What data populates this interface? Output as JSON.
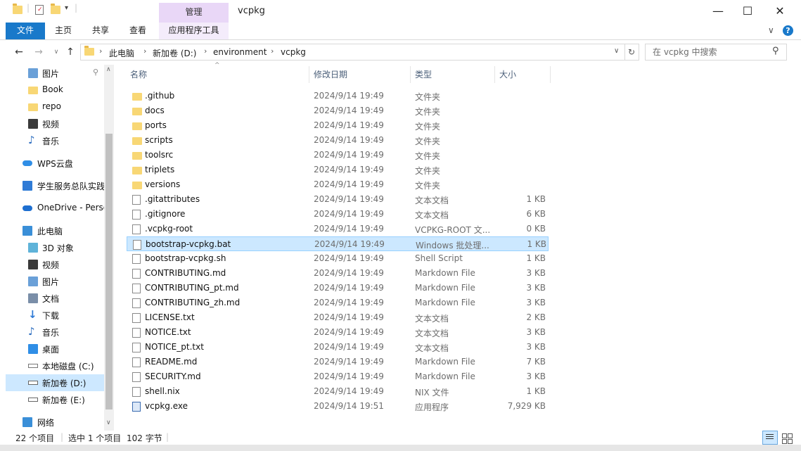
{
  "window": {
    "title": "vcpkg",
    "manage_label": "管理",
    "minimize": "—",
    "maximize": "☐",
    "close": "✕"
  },
  "ribbon": {
    "tabs": [
      "文件",
      "主页",
      "共享",
      "查看",
      "应用程序工具"
    ],
    "collapse": "∨",
    "help": "?"
  },
  "address": {
    "crumbs": [
      "此电脑",
      "新加卷 (D:)",
      "environment",
      "vcpkg"
    ],
    "search_placeholder": "在 vcpkg 中搜索"
  },
  "nav": {
    "items": [
      {
        "label": "图片",
        "icon": "pictures-icon",
        "pinned": true
      },
      {
        "label": "Book",
        "icon": "folder-icon"
      },
      {
        "label": "repo",
        "icon": "folder-icon"
      },
      {
        "label": "视频",
        "icon": "videos-icon"
      },
      {
        "label": "音乐",
        "icon": "music-icon"
      },
      {
        "label": "WPS云盘",
        "icon": "cloud-icon"
      },
      {
        "label": "学生服务总队实践",
        "icon": "cube-icon"
      },
      {
        "label": "OneDrive - Perso",
        "icon": "onedrive-icon"
      },
      {
        "label": "此电脑",
        "icon": "this-pc-icon"
      },
      {
        "label": "3D 对象",
        "icon": "3d-objects-icon"
      },
      {
        "label": "视频",
        "icon": "videos-icon"
      },
      {
        "label": "图片",
        "icon": "pictures-icon"
      },
      {
        "label": "文档",
        "icon": "documents-icon"
      },
      {
        "label": "下载",
        "icon": "downloads-icon"
      },
      {
        "label": "音乐",
        "icon": "music-icon"
      },
      {
        "label": "桌面",
        "icon": "desktop-icon"
      },
      {
        "label": "本地磁盘 (C:)",
        "icon": "drive-c-icon"
      },
      {
        "label": "新加卷 (D:)",
        "icon": "drive-icon",
        "selected": true
      },
      {
        "label": "新加卷 (E:)",
        "icon": "drive-icon"
      },
      {
        "label": "网络",
        "icon": "network-icon"
      }
    ]
  },
  "columns": {
    "name": "名称",
    "date": "修改日期",
    "type": "类型",
    "size": "大小"
  },
  "files": [
    {
      "name": ".github",
      "date": "2024/9/14 19:49",
      "type": "文件夹",
      "size": "",
      "kind": "folder"
    },
    {
      "name": "docs",
      "date": "2024/9/14 19:49",
      "type": "文件夹",
      "size": "",
      "kind": "folder"
    },
    {
      "name": "ports",
      "date": "2024/9/14 19:49",
      "type": "文件夹",
      "size": "",
      "kind": "folder"
    },
    {
      "name": "scripts",
      "date": "2024/9/14 19:49",
      "type": "文件夹",
      "size": "",
      "kind": "folder"
    },
    {
      "name": "toolsrc",
      "date": "2024/9/14 19:49",
      "type": "文件夹",
      "size": "",
      "kind": "folder"
    },
    {
      "name": "triplets",
      "date": "2024/9/14 19:49",
      "type": "文件夹",
      "size": "",
      "kind": "folder"
    },
    {
      "name": "versions",
      "date": "2024/9/14 19:49",
      "type": "文件夹",
      "size": "",
      "kind": "folder"
    },
    {
      "name": ".gitattributes",
      "date": "2024/9/14 19:49",
      "type": "文本文档",
      "size": "1 KB",
      "kind": "doc"
    },
    {
      "name": ".gitignore",
      "date": "2024/9/14 19:49",
      "type": "文本文档",
      "size": "6 KB",
      "kind": "doc"
    },
    {
      "name": ".vcpkg-root",
      "date": "2024/9/14 19:49",
      "type": "VCPKG-ROOT 文...",
      "size": "0 KB",
      "kind": "doc"
    },
    {
      "name": "bootstrap-vcpkg.bat",
      "date": "2024/9/14 19:49",
      "type": "Windows 批处理...",
      "size": "1 KB",
      "kind": "doc",
      "selected": true
    },
    {
      "name": "bootstrap-vcpkg.sh",
      "date": "2024/9/14 19:49",
      "type": "Shell Script",
      "size": "1 KB",
      "kind": "doc"
    },
    {
      "name": "CONTRIBUTING.md",
      "date": "2024/9/14 19:49",
      "type": "Markdown File",
      "size": "3 KB",
      "kind": "doc"
    },
    {
      "name": "CONTRIBUTING_pt.md",
      "date": "2024/9/14 19:49",
      "type": "Markdown File",
      "size": "3 KB",
      "kind": "doc"
    },
    {
      "name": "CONTRIBUTING_zh.md",
      "date": "2024/9/14 19:49",
      "type": "Markdown File",
      "size": "3 KB",
      "kind": "doc"
    },
    {
      "name": "LICENSE.txt",
      "date": "2024/9/14 19:49",
      "type": "文本文档",
      "size": "2 KB",
      "kind": "doc"
    },
    {
      "name": "NOTICE.txt",
      "date": "2024/9/14 19:49",
      "type": "文本文档",
      "size": "3 KB",
      "kind": "doc"
    },
    {
      "name": "NOTICE_pt.txt",
      "date": "2024/9/14 19:49",
      "type": "文本文档",
      "size": "3 KB",
      "kind": "doc"
    },
    {
      "name": "README.md",
      "date": "2024/9/14 19:49",
      "type": "Markdown File",
      "size": "7 KB",
      "kind": "doc"
    },
    {
      "name": "SECURITY.md",
      "date": "2024/9/14 19:49",
      "type": "Markdown File",
      "size": "3 KB",
      "kind": "doc"
    },
    {
      "name": "shell.nix",
      "date": "2024/9/14 19:49",
      "type": "NIX 文件",
      "size": "1 KB",
      "kind": "doc"
    },
    {
      "name": "vcpkg.exe",
      "date": "2024/9/14 19:51",
      "type": "应用程序",
      "size": "7,929 KB",
      "kind": "exe"
    }
  ],
  "status": {
    "count": "22 个项目",
    "selection": "选中 1 个项目",
    "bytes": "102 字节"
  },
  "colors": {
    "accent": "#1979ca",
    "selection": "#cce8ff",
    "manage_tab": "#e9d7f7"
  }
}
